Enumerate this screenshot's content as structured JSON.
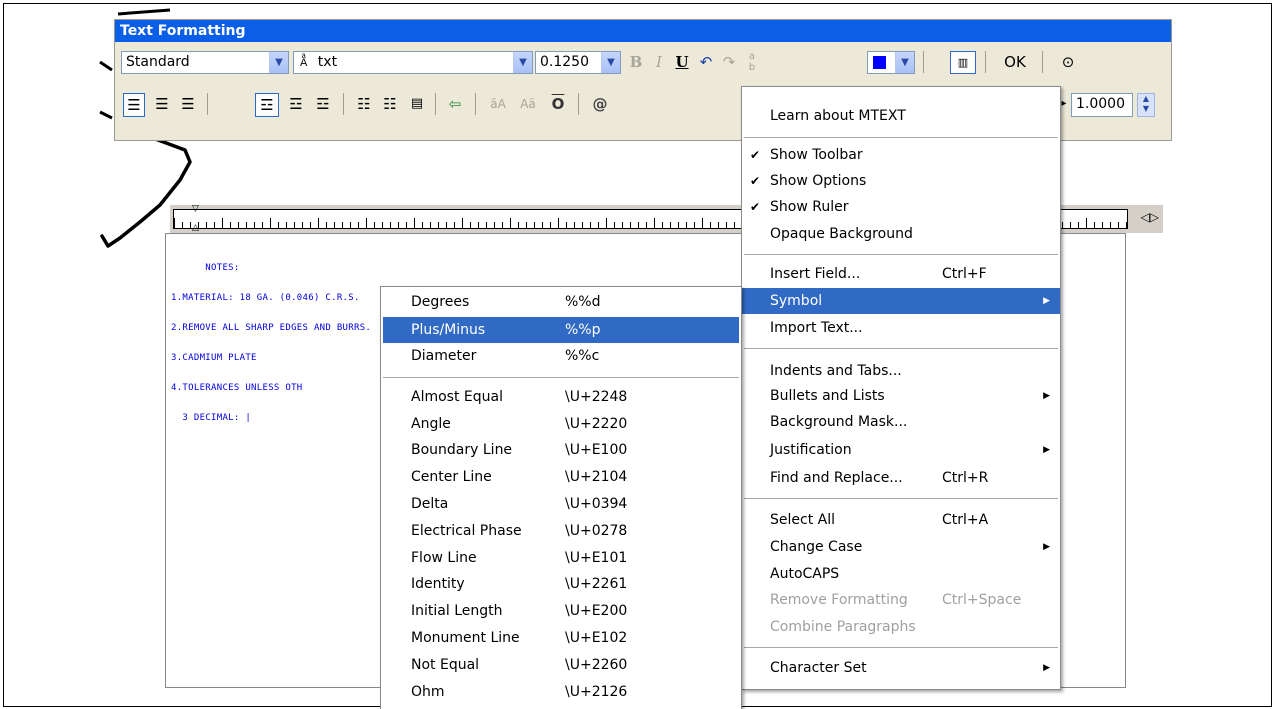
{
  "toolbar": {
    "title": "Text Formatting",
    "style_value": "Standard",
    "font_value": "txt",
    "height_value": "0.1250",
    "bold_label": "B",
    "italic_label": "I",
    "underline_label": "U",
    "ok_label": "OK",
    "spacing_value": "1.0000",
    "at_label": "@",
    "color_swatch": "#0000ff",
    "title_bar_color": "#0a5ee8"
  },
  "editor": {
    "notes_lines": [
      "      NOTES:",
      "1.MATERIAL: 18 GA. (0.046) C.R.S.",
      "2.REMOVE ALL SHARP EDGES AND BURRS.",
      "3.CADMIUM PLATE",
      "4.TOLERANCES UNLESS OTH",
      "  3 DECIMAL: |"
    ],
    "text_color": "#0000e0"
  },
  "context_menu": {
    "items": [
      {
        "label": "Learn about MTEXT"
      },
      {
        "label": "Show Toolbar",
        "checked": true
      },
      {
        "label": "Show Options",
        "checked": true
      },
      {
        "label": "Show Ruler",
        "checked": true
      },
      {
        "label": "Opaque Background"
      },
      {
        "label": "Insert Field...",
        "shortcut": "Ctrl+F"
      },
      {
        "label": "Symbol",
        "submenu": true,
        "highlighted": true
      },
      {
        "label": "Import Text..."
      },
      {
        "label": "Indents and Tabs..."
      },
      {
        "label": "Bullets and Lists",
        "submenu": true
      },
      {
        "label": "Background Mask..."
      },
      {
        "label": "Justification",
        "submenu": true
      },
      {
        "label": "Find and Replace...",
        "shortcut": "Ctrl+R"
      },
      {
        "label": "Select All",
        "shortcut": "Ctrl+A"
      },
      {
        "label": "Change Case",
        "submenu": true
      },
      {
        "label": "AutoCAPS"
      },
      {
        "label": "Remove Formatting",
        "shortcut": "Ctrl+Space",
        "disabled": true
      },
      {
        "label": "Combine Paragraphs",
        "disabled": true
      },
      {
        "label": "Character Set",
        "submenu": true
      }
    ]
  },
  "symbol_menu": {
    "items": [
      {
        "label": "Degrees",
        "code": "%%d"
      },
      {
        "label": "Plus/Minus",
        "code": "%%p",
        "highlighted": true
      },
      {
        "label": "Diameter",
        "code": "%%c"
      },
      {
        "label": "Almost Equal",
        "code": "\\U+2248"
      },
      {
        "label": "Angle",
        "code": "\\U+2220"
      },
      {
        "label": "Boundary Line",
        "code": "\\U+E100"
      },
      {
        "label": "Center Line",
        "code": "\\U+2104"
      },
      {
        "label": "Delta",
        "code": "\\U+0394"
      },
      {
        "label": "Electrical Phase",
        "code": "\\U+0278"
      },
      {
        "label": "Flow Line",
        "code": "\\U+E101"
      },
      {
        "label": "Identity",
        "code": "\\U+2261"
      },
      {
        "label": "Initial Length",
        "code": "\\U+E200"
      },
      {
        "label": "Monument Line",
        "code": "\\U+E102"
      },
      {
        "label": "Not Equal",
        "code": "\\U+2260"
      },
      {
        "label": "Ohm",
        "code": "\\U+2126"
      }
    ]
  },
  "highlight_color": "#316ac5"
}
